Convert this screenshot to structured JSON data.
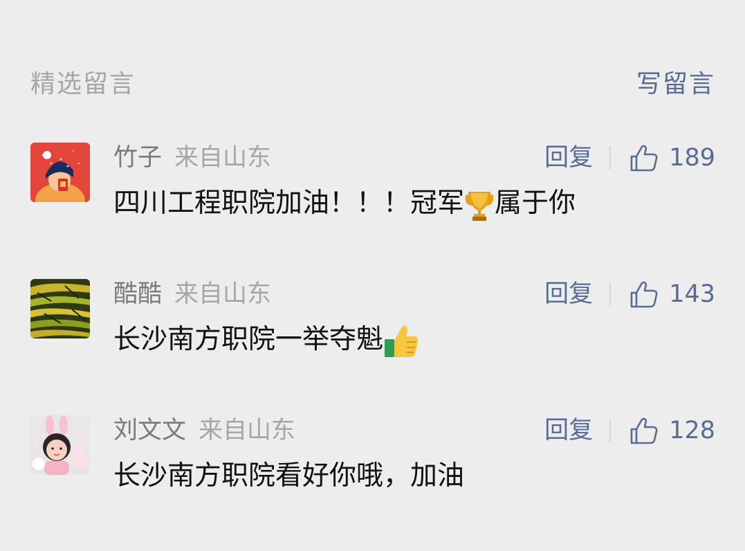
{
  "header": {
    "title": "精选留言",
    "write_label": "写留言"
  },
  "comments": [
    {
      "nickname": "竹子",
      "location": "来自山东",
      "reply_label": "回复",
      "likes": "189",
      "text_before": "四川工程职院加油！！！冠军",
      "emoji_name": "trophy-emoji",
      "text_after": "属于你"
    },
    {
      "nickname": "酷酷",
      "location": "来自山东",
      "reply_label": "回复",
      "likes": "143",
      "text_before": "长沙南方职院一举夺魁",
      "emoji_name": "thumbs-up-emoji",
      "text_after": ""
    },
    {
      "nickname": "刘文文",
      "location": "来自山东",
      "reply_label": "回复",
      "likes": "128",
      "text_before": "长沙南方职院看好你哦，加油",
      "text_after": ""
    }
  ],
  "colors": {
    "background": "#ededed",
    "link": "#576b95",
    "muted": "#a6a6a6",
    "text": "#111111"
  }
}
